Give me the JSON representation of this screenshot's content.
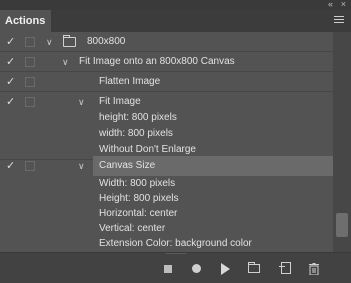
{
  "window": {
    "collapse_glyph": "«",
    "close_glyph": "×"
  },
  "panel": {
    "tab_label": "Actions",
    "menu_icon": "panel-menu-icon"
  },
  "rows": [
    {
      "label": "800x800",
      "check": "✓",
      "indent": 0,
      "chevron": "∨",
      "folder": true
    },
    {
      "label": "Fit Image onto an 800x800 Canvas",
      "check": "✓",
      "indent": 1,
      "chevron": "∨"
    },
    {
      "label": "Flatten Image",
      "check": "✓",
      "indent": 2
    },
    {
      "label": "Fit Image",
      "check": "✓",
      "indent": 2,
      "chevron": "∨"
    },
    {
      "label": "height: 800 pixels",
      "indent": 3
    },
    {
      "label": "width: 800 pixels",
      "indent": 3
    },
    {
      "label": "Without Don't Enlarge",
      "indent": 3
    },
    {
      "label": "Canvas Size",
      "check": "✓",
      "indent": 2,
      "chevron": "∨",
      "selected": true
    },
    {
      "label": "Width: 800 pixels",
      "indent": 3
    },
    {
      "label": "Height: 800 pixels",
      "indent": 3
    },
    {
      "label": "Horizontal: center",
      "indent": 3
    },
    {
      "label": "Vertical: center",
      "indent": 3
    },
    {
      "label": "Extension Color: background color",
      "indent": 3
    }
  ],
  "footer": {
    "icons": [
      "stop-icon",
      "record-icon",
      "play-icon",
      "folder-icon",
      "new-action-icon",
      "trash-icon"
    ]
  }
}
